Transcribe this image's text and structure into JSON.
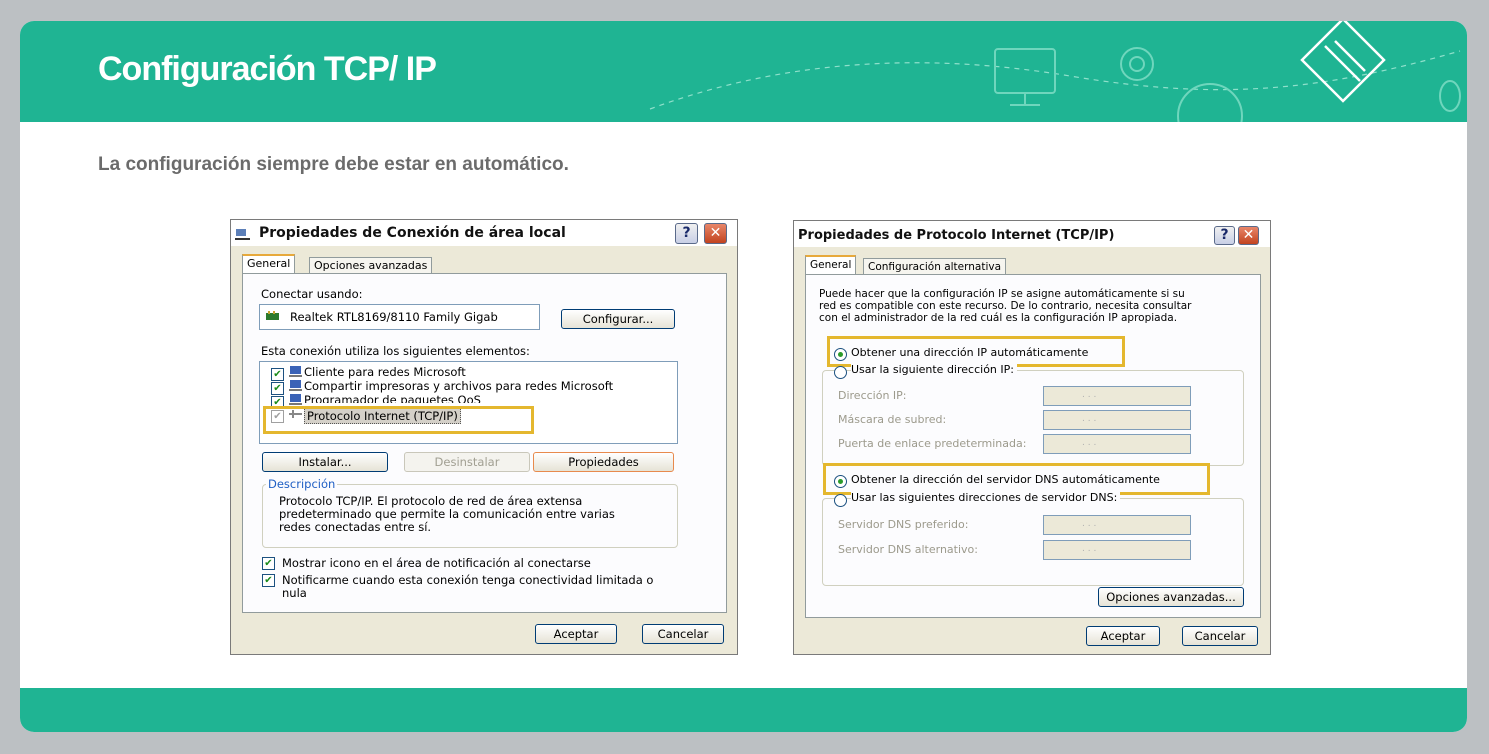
{
  "slide": {
    "title": "Configuración TCP/ IP",
    "subtitle": "La configuración siempre debe estar en automático."
  },
  "left_dialog": {
    "title": "Propiedades de Conexión de área local",
    "help_label": "?",
    "close_label": "✕",
    "tabs": [
      "General",
      "Opciones avanzadas"
    ],
    "connect_using_label": "Conectar usando:",
    "adapter_name": "Realtek RTL8169/8110 Family Gigab",
    "configure_button": "Configurar...",
    "elements_label": "Esta conexión utiliza los siguientes elementos:",
    "components": [
      {
        "label": "Cliente para redes Microsoft",
        "checked": true
      },
      {
        "label": "Compartir impresoras y archivos para redes Microsoft",
        "checked": true
      },
      {
        "label": "Programador de paquetes QoS",
        "checked": true
      },
      {
        "label": "Protocolo Internet (TCP/IP)",
        "checked": true,
        "selected": true
      }
    ],
    "install_button": "Instalar...",
    "uninstall_button": "Desinstalar",
    "properties_button": "Propiedades",
    "description_label": "Descripción",
    "description_text_1": "Protocolo TCP/IP. El protocolo de red de área extensa",
    "description_text_2": "predeterminado que permite la comunicación entre varias",
    "description_text_3": "redes conectadas entre sí.",
    "show_icon_label": "Mostrar icono en el área de notificación al conectarse",
    "notify_label_1": "Notificarme cuando esta conexión tenga conectividad limitada o",
    "notify_label_2": "nula",
    "accept_button": "Aceptar",
    "cancel_button": "Cancelar"
  },
  "right_dialog": {
    "title": "Propiedades de Protocolo Internet (TCP/IP)",
    "help_label": "?",
    "close_label": "✕",
    "tabs": [
      "General",
      "Configuración alternativa"
    ],
    "intro_1": "Puede hacer que la configuración IP se asigne automáticamente si su",
    "intro_2": "red es compatible con este recurso. De lo contrario, necesita consultar",
    "intro_3": "con el administrador de la red cuál es la configuración IP apropiada.",
    "auto_ip_label": "Obtener una dirección IP automáticamente",
    "manual_ip_label": "Usar la siguiente dirección IP:",
    "ip_address_label": "Dirección IP:",
    "subnet_mask_label": "Máscara de subred:",
    "gateway_label": "Puerta de enlace predeterminada:",
    "auto_dns_label": "Obtener la dirección del servidor DNS automáticamente",
    "manual_dns_label": "Usar las siguientes direcciones de servidor DNS:",
    "preferred_dns_label": "Servidor DNS preferido:",
    "alternate_dns_label": "Servidor DNS alternativo:",
    "ip_dots": ".          .          .",
    "advanced_button": "Opciones avanzadas...",
    "accept_button": "Aceptar",
    "cancel_button": "Cancelar"
  },
  "colors": {
    "header_green": "#1fb493",
    "highlight_yellow": "#e4b72e"
  }
}
